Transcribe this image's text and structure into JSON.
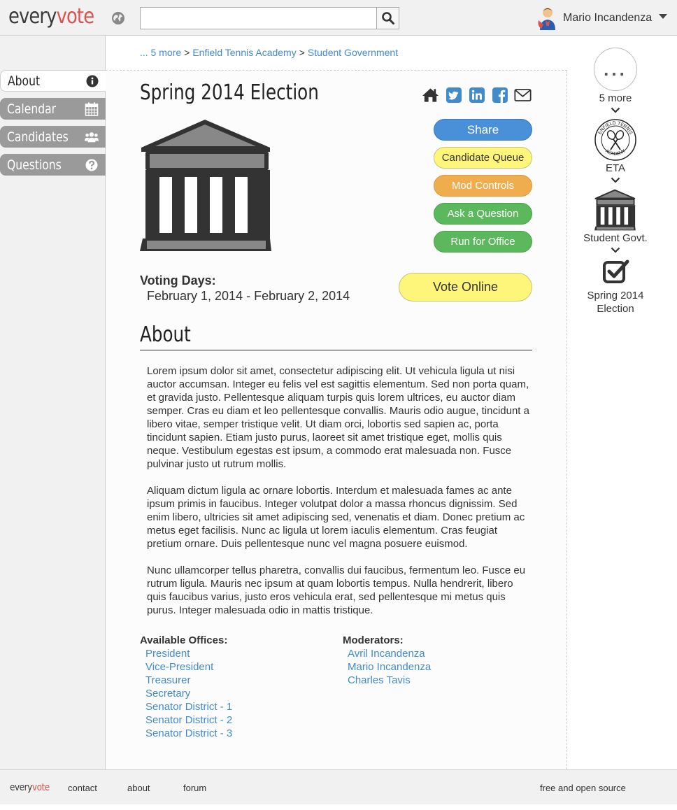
{
  "header": {
    "logo_a": "every",
    "logo_b": "vote",
    "search_value": "",
    "user_name": "Mario Incandenza"
  },
  "breadcrumb": {
    "more": "... 5 more",
    "sep1": ">",
    "academy": "Enfield Tennis Academy",
    "sep2": ">",
    "govt": "Student Government"
  },
  "leftnav": {
    "items": [
      {
        "label": "About",
        "icon": "info-circle-icon"
      },
      {
        "label": "Calendar",
        "icon": "calendar-icon"
      },
      {
        "label": "Candidates",
        "icon": "users-icon"
      },
      {
        "label": "Questions",
        "icon": "question-circle-icon"
      }
    ]
  },
  "main": {
    "title": "Spring 2014 Election",
    "buttons": {
      "share": "Share",
      "queue": "Candidate Queue",
      "mod": "Mod Controls",
      "ask": "Ask a Question",
      "run": "Run for Office",
      "vote": "Vote Online"
    },
    "voting_days_label": "Voting Days:",
    "voting_days": "February 1, 2014 - February 2, 2014",
    "about_heading": "About",
    "paragraphs": [
      "Lorem ipsum dolor sit amet, consectetur adipiscing elit. Ut vehicula ligula ut nisi auctor accumsan. Integer eu felis vel est sagittis elementum. Sed non porta quam, et gravida justo. Pellentesque aliquam turpis quis lorem ultrices, eu auctor diam semper. Cras eu diam et leo pellentesque convallis. Mauris odio augue, tincidunt a libero vitae, semper tristique velit. Ut diam orci, lobortis sed sapien ac, porta tincidunt sapien. Etiam justo purus, laoreet sit amet tristique eget, mollis quis neque. Vestibulum egestas est ipsum, a commodo erat malesuada non. Fusce pulvinar justo ut rutrum mollis.",
      "Aliquam dictum ligula ac ornare lobortis. Interdum et malesuada fames ac ante ipsum primis in faucibus. Integer volutpat dolor a massa rhoncus dignissim. Sed enim libero, ultricies sit amet adipiscing sed, venenatis et diam. Donec pretium ac metus eget facilisis. Nunc ac ligula ut lorem iaculis elementum. Cras feugiat pretium ornare. Duis pellentesque nunc vel magna posuere euismod.",
      "Nunc ullamcorper tellus pharetra, convallis dui faucibus, fermentum leo. Fusce eu rutrum ligula. Mauris nec ipsum at quam lobortis tempus. Nulla hendrerit, libero quis faucibus varius, justo eros vehicula erat, sed pellentesque mi metus quis purus. Integer malesuada odio in mattis tristique."
    ],
    "offices_label": "Available Offices:",
    "offices": [
      "President",
      "Vice-President",
      "Treasurer",
      "Secretary",
      "Senator District - 1",
      "Senator District - 2",
      "Senator District - 3"
    ],
    "moderators_label": "Moderators:",
    "moderators": [
      "Avril Incandenza",
      "Mario Incandenza",
      "Charles Tavis"
    ]
  },
  "rightrail": {
    "more_dots": "...",
    "more_label": "5 more",
    "eta_label": "ETA",
    "seal_text": "ENFIELD TENNIS ACADEMY",
    "govt_label": "Student Govt.",
    "election_label_1": "Spring 2014",
    "election_label_2": "Election"
  },
  "footer": {
    "logo_a": "every",
    "logo_b": "vote",
    "contact": "contact",
    "about": "about",
    "forum": "forum",
    "license": "free and open source"
  },
  "colors": {
    "accent_red": "#d9534f",
    "link_blue": "#428bca",
    "share_blue": "#4a90d9",
    "yellow": "#fdf67a",
    "orange": "#f0ad4e",
    "green": "#5cb85c",
    "nav_gray": "#9a9a9a"
  }
}
